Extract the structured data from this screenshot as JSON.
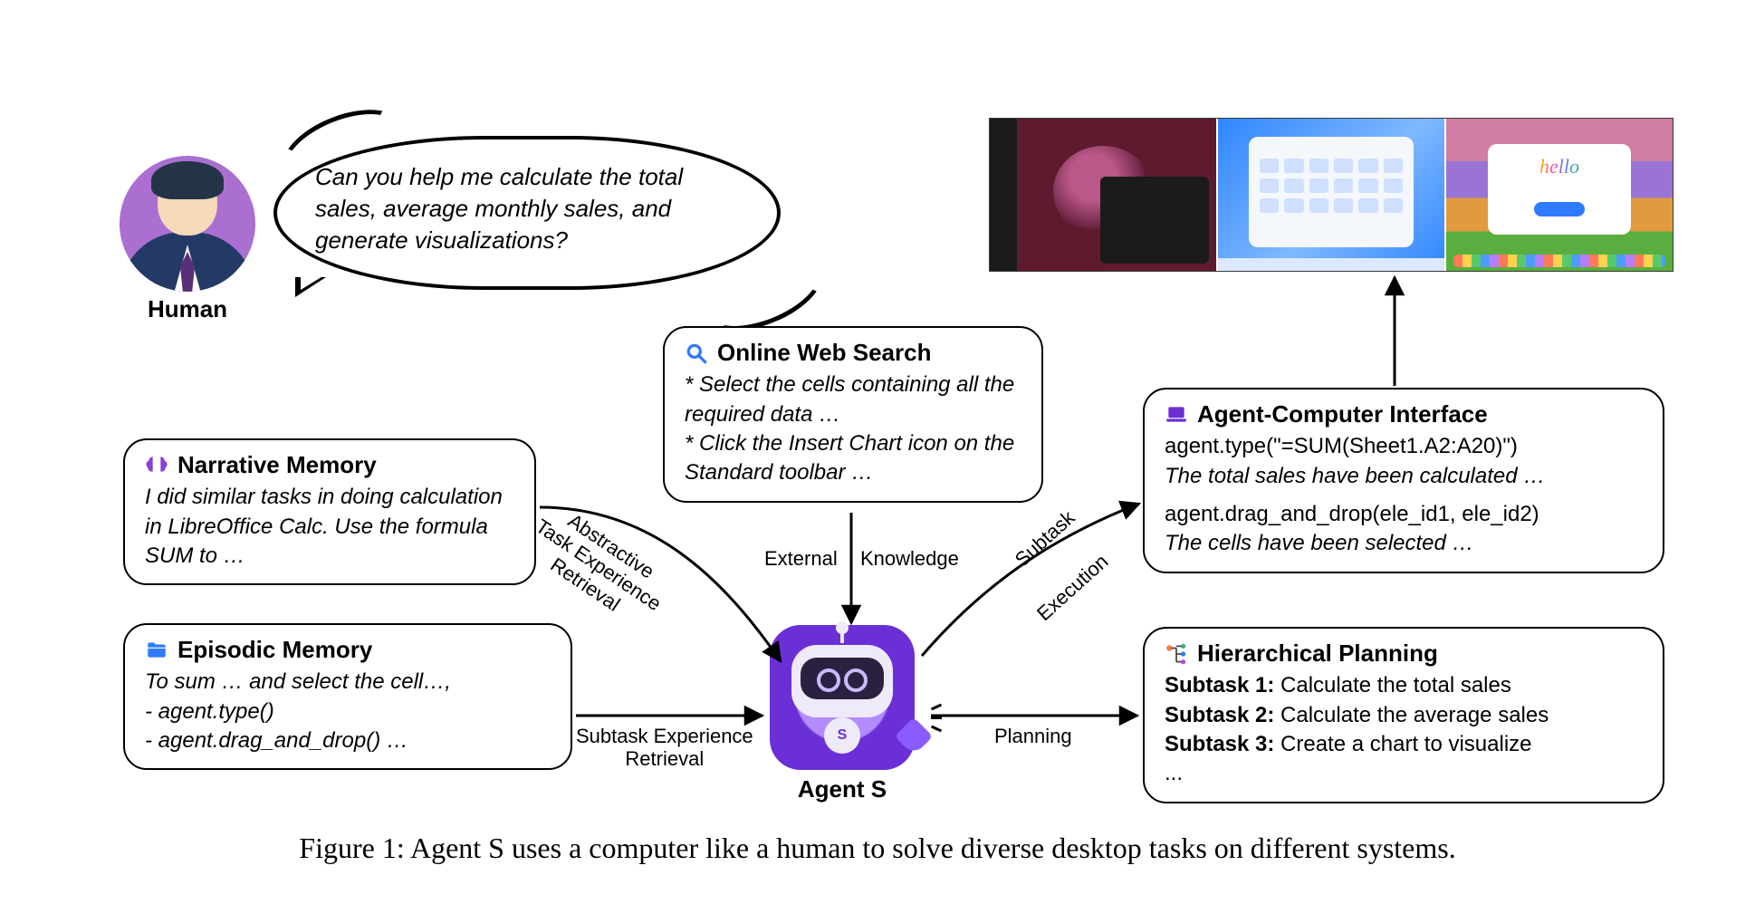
{
  "human": {
    "label": "Human"
  },
  "bubble": {
    "text": "Can you help me calculate the total sales, average monthly sales, and generate visualizations?"
  },
  "narrative": {
    "title": "Narrative Memory",
    "body": "I did similar tasks in doing calculation in LibreOffice Calc. Use the formula SUM to …"
  },
  "episodic": {
    "title": "Episodic Memory",
    "intro": "To sum … and select the cell…,",
    "bullet1": "-   agent.type()",
    "bullet2": "-   agent.drag_and_drop() …"
  },
  "websearch": {
    "title": "Online Web Search",
    "line1": "* Select the cells containing all the required data …",
    "line2": "* Click the Insert Chart icon on the Standard toolbar …"
  },
  "aci": {
    "title": "Agent-Computer Interface",
    "code1": "agent.type(\"=SUM(Sheet1.A2:A20)\")",
    "note1": "The total sales have been calculated …",
    "code2": "agent.drag_and_drop(ele_id1, ele_id2)",
    "note2": "The cells have been selected …"
  },
  "plan": {
    "title": "Hierarchical Planning",
    "s1p": "Subtask 1:",
    "s1": " Calculate the total sales",
    "s2p": "Subtask 2:",
    "s2": " Calculate the average sales",
    "s3p": "Subtask 3:",
    "s3": " Create a chart to visualize",
    "ell": "..."
  },
  "edges": {
    "abstractive": "Abstractive\nTask Experience\nRetrieval",
    "subexp": "Subtask Experience\nRetrieval",
    "external": "External",
    "knowledge": "Knowledge",
    "subtask": "Subtask",
    "execution": "Execution",
    "planning": "Planning"
  },
  "agent": {
    "label": "Agent S",
    "badge": "S"
  },
  "shots": {
    "os1": "Ubuntu desktop",
    "os2": "Windows 11 desktop",
    "os3": "macOS desktop",
    "hello": "hello"
  },
  "caption": "Figure 1: Agent S uses a computer like a human to solve diverse desktop tasks on different systems."
}
